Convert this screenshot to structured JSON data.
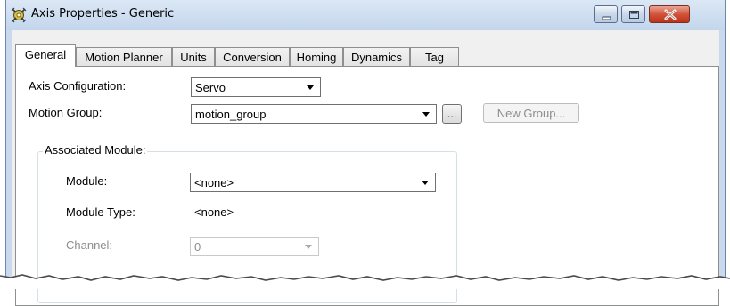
{
  "window": {
    "title": "Axis Properties - Generic"
  },
  "tabs": [
    {
      "label": "General",
      "active": true
    },
    {
      "label": "Motion Planner",
      "active": false
    },
    {
      "label": "Units",
      "active": false
    },
    {
      "label": "Conversion",
      "active": false
    },
    {
      "label": "Homing",
      "active": false
    },
    {
      "label": "Dynamics",
      "active": false
    },
    {
      "label": "Tag",
      "active": false
    }
  ],
  "general": {
    "axis_configuration_label": "Axis Configuration:",
    "axis_configuration_value": "Servo",
    "motion_group_label": "Motion Group:",
    "motion_group_value": "motion_group",
    "browse_label": "...",
    "new_group_label": "New Group...",
    "associated_module": {
      "title": "Associated Module:",
      "module_label": "Module:",
      "module_value": "<none>",
      "module_type_label": "Module Type:",
      "module_type_value": "<none>",
      "channel_label": "Channel:",
      "channel_value": "0"
    }
  },
  "colors": {
    "titlebar": "#c3d6ec",
    "close_button": "#d2533b",
    "page_background": "#ffffff",
    "disabled_text": "#8d8d8d"
  }
}
